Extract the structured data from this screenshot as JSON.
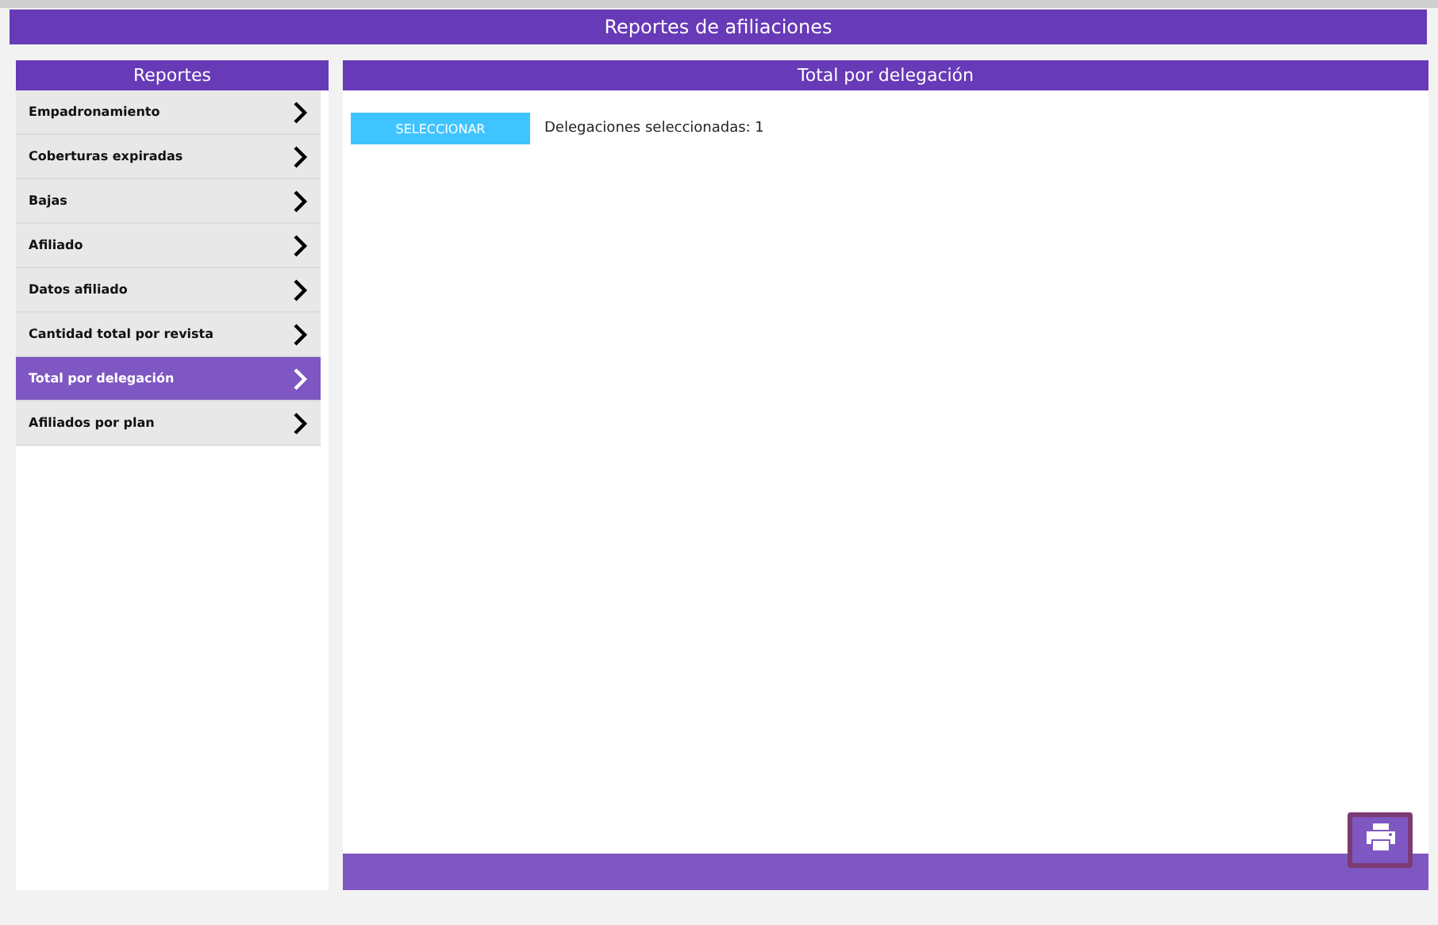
{
  "header": {
    "title": "Reportes de afiliaciones"
  },
  "sidebar": {
    "title": "Reportes",
    "items": [
      {
        "label": "Empadronamiento",
        "selected": false
      },
      {
        "label": "Coberturas expiradas",
        "selected": false
      },
      {
        "label": "Bajas",
        "selected": false
      },
      {
        "label": "Afiliado",
        "selected": false
      },
      {
        "label": "Datos afiliado",
        "selected": false
      },
      {
        "label": "Cantidad total por revista",
        "selected": false
      },
      {
        "label": "Total por delegación",
        "selected": true
      },
      {
        "label": "Afiliados por plan",
        "selected": false
      }
    ]
  },
  "main": {
    "title": "Total por delegación",
    "select_button": "SELECCIONAR",
    "selection_status": "Delegaciones seleccionadas: 1"
  }
}
